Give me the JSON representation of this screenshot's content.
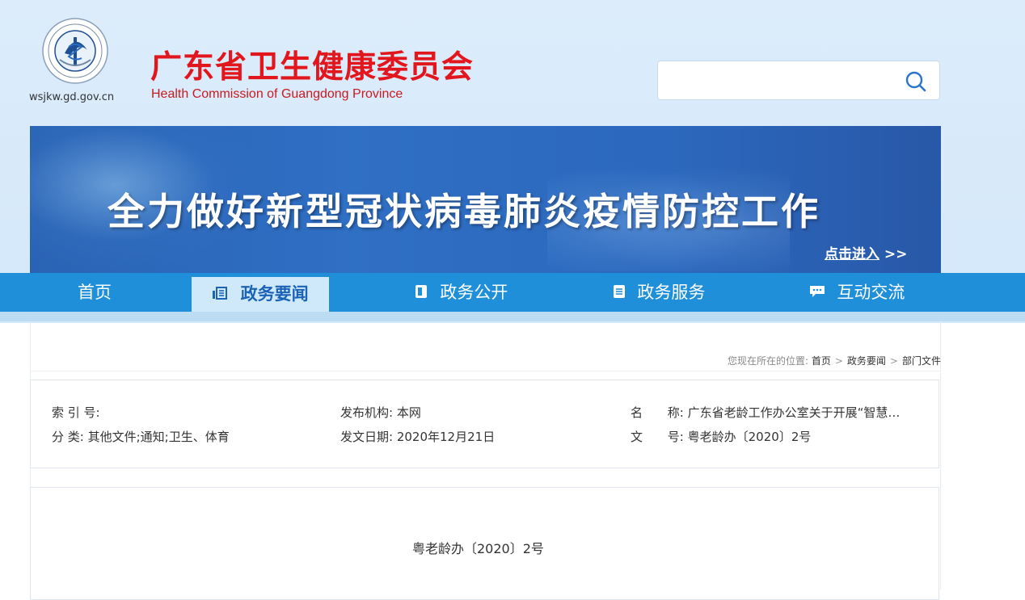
{
  "header": {
    "title": "广东省卫生健康委员会",
    "subtitle": "Health Commission of Guangdong Province",
    "domain": "wsjkw.gd.gov.cn",
    "logo_icon": "health-commission-emblem-icon",
    "search": {
      "placeholder": "",
      "icon": "search-icon"
    }
  },
  "banner": {
    "title": "全力做好新型冠状病毒肺炎疫情防控工作",
    "enter_label": "点击进入",
    "enter_arrows": ">>"
  },
  "nav": {
    "items": [
      {
        "label": "首页",
        "icon": ""
      },
      {
        "label": "政务要闻",
        "icon": "news-icon",
        "active": true
      },
      {
        "label": "政务公开",
        "icon": "book-icon"
      },
      {
        "label": "政务服务",
        "icon": "document-icon"
      },
      {
        "label": "互动交流",
        "icon": "chat-icon"
      }
    ]
  },
  "breadcrumb": {
    "prefix": "您现在所在的位置:",
    "items": [
      "首页",
      "政务要闻",
      "部门文件"
    ],
    "separator": ">"
  },
  "info": {
    "index_label": "索 引 号:",
    "index_value": "",
    "category_label": "分 类:",
    "category_value": "其他文件;通知;卫生、体育",
    "publisher_label": "发布机构:",
    "publisher_value": "本网",
    "date_label": "发文日期:",
    "date_value": "2020年12月21日",
    "name_label_1": "名",
    "name_label_2": "称:",
    "name_value": "广东省老龄工作办公室关于开展“智慧…",
    "docno_label_1": "文",
    "docno_label_2": "号:",
    "docno_value": "粤老龄办〔2020〕2号"
  },
  "document": {
    "number": "粤老龄办〔2020〕2号"
  },
  "colors": {
    "title_red": "#e2171d",
    "nav_blue": "#1e8fd8",
    "nav_active_bg": "#cfe8fa",
    "banner_blue": "#2f6fc4"
  }
}
